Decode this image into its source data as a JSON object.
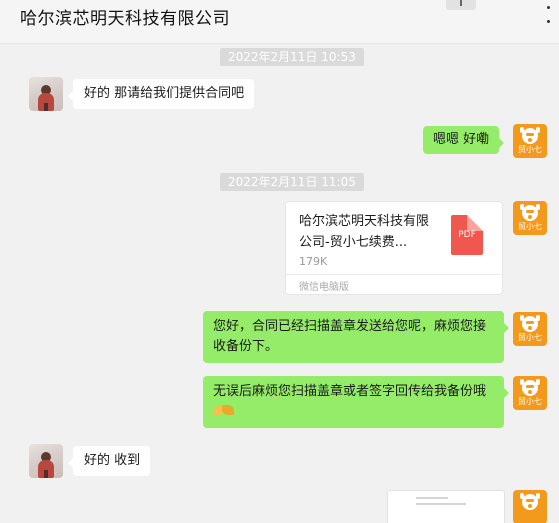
{
  "window": {
    "title": "哈尔滨芯明天科技有限公司"
  },
  "messages": {
    "time1": "2022年2月11日  10:53",
    "msg1": "好的 那请给我们提供合同吧",
    "msg2": "嗯嗯 好嘞",
    "time2": "2022年2月11日  11:05",
    "file": {
      "name": "哈尔滨芯明天科技有限公司-贸小七续费...",
      "size": "179K",
      "source": "微信电脑版",
      "type_label": "PDF"
    },
    "msg3": "您好，合同已经扫描盖章发送给您呢，麻烦您接收备份下。",
    "msg4": "无误后麻烦您扫描盖章或者签字回传给我备份哦",
    "msg5": "好的 收到"
  },
  "contacts": {
    "self_avatar_label": "贸小七"
  },
  "icons": {
    "more": "more-vertical-icon",
    "file": "pdf-file-icon",
    "emoji": "handshake-icon"
  },
  "colors": {
    "sent_bubble": "#95ec69",
    "received_bubble": "#ffffff",
    "self_avatar": "#f39a1d",
    "pdf": "#f0574e"
  }
}
